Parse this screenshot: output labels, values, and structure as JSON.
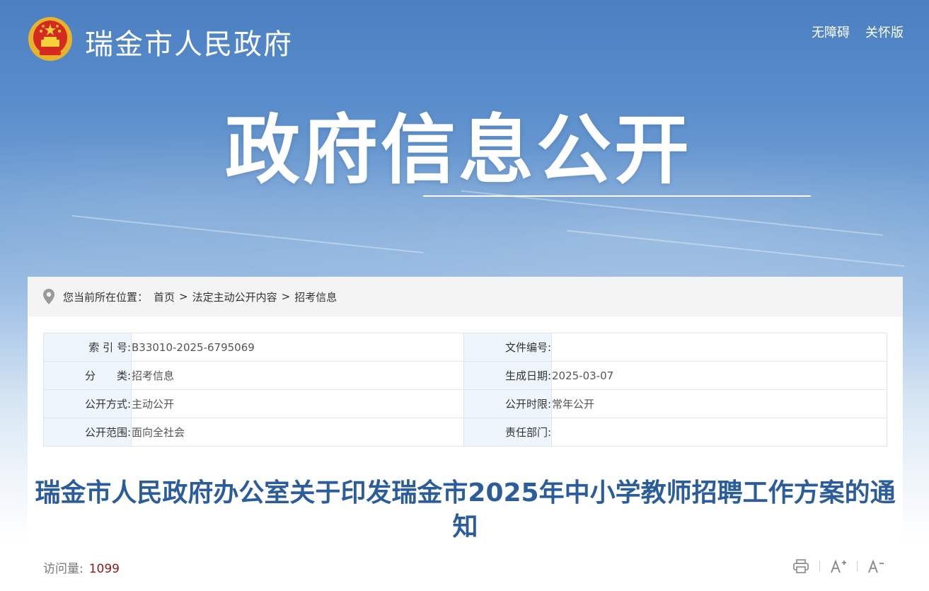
{
  "header": {
    "site_title": "瑞金市人民政府",
    "links": [
      "无障碍",
      "关怀版"
    ]
  },
  "hero": {
    "title": "政府信息公开"
  },
  "breadcrumb": {
    "prefix": "您当前所在位置：",
    "items": [
      "首页",
      "法定主动公开内容",
      "招考信息"
    ]
  },
  "meta": {
    "rows": [
      {
        "l1": "索 引 号:",
        "v1": "B33010-2025-6795069",
        "l2": "文件编号:",
        "v2": ""
      },
      {
        "l1": "分　　类:",
        "v1": "招考信息",
        "l2": "生成日期:",
        "v2": "2025-03-07"
      },
      {
        "l1": "公开方式:",
        "v1": "主动公开",
        "l2": "公开时限:",
        "v2": "常年公开"
      },
      {
        "l1": "公开范围:",
        "v1": "面向全社会",
        "l2": "责任部门:",
        "v2": ""
      }
    ]
  },
  "article": {
    "title": "瑞金市人民政府办公室关于印发瑞金市2025年中小学教师招聘工作方案的通知",
    "visits_label": "访问量:",
    "visits_count": "1099"
  },
  "icons": {
    "emblem": "national-emblem-icon",
    "location": "location-pin-icon",
    "print": "print-icon",
    "font_increase": "font-increase-icon",
    "font_decrease": "font-decrease-icon"
  },
  "colors": {
    "title_blue": "#2b5d9a",
    "visits_red": "#8b1a1a",
    "label_bg": "#eef5fc"
  }
}
